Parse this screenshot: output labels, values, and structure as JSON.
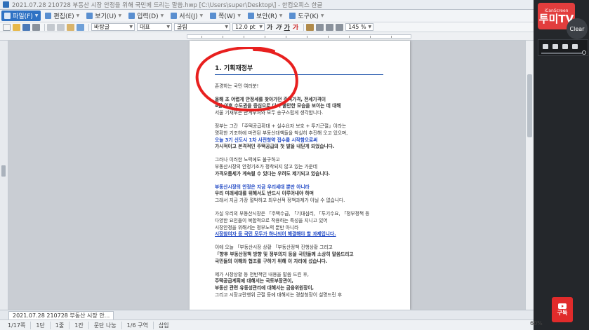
{
  "window": {
    "title": "2021.07.28 210728 부동산 시장 안정을 위해 국민께 드리는 말씀.hwp [C:\\Users\\super\\Desktop\\] - 한컴오피스 한글"
  },
  "menubar": {
    "items": [
      {
        "label": "파일(F)",
        "active": true
      },
      {
        "label": "편집(E)"
      },
      {
        "label": "보기(U)"
      },
      {
        "label": "입력(D)"
      },
      {
        "label": "서식(J)"
      },
      {
        "label": "쪽(W)"
      },
      {
        "label": "보안(R)"
      },
      {
        "label": "도구(K)"
      }
    ]
  },
  "toolbar": {
    "style": "바탕글",
    "font_group": "대표",
    "font": "굴림",
    "font_size": "12.0",
    "font_unit": "pt",
    "zoom_field": "145",
    "zoom_unit": "%",
    "bold_glyph": "가",
    "italic_glyph": "가",
    "underline_glyph": "가",
    "color_glyph": "가"
  },
  "document": {
    "heading": "1. 기획재정부",
    "greeting": "존경하는 국민 여러분!",
    "paragraphs": [
      [
        "올해 초 어렵게 안정세를 찾아가던 주택가격, 전세가격이",
        "4월 이후 수도권을 중심으로 다시 불안한 모습을 보이는 데 대해",
        "서울 기재부는 관계부처와 모두 송구스럽게 생각합니다."
      ],
      [
        "정부는 그간 「주택공급확대 + 실수요자 보호 + 투기근절」이라는",
        "명확한 기조하에 마련된 부동산대책들을 착실히 추진해 오고 있으며,",
        "오늘 3기 신도시 1차 사전청약 접수를 시작함으로써",
        "가시적이고 본격적인 주택공급의 첫 발을 내딛게 되었습니다."
      ],
      [
        "그러나 이러한 노력에도 불구하고",
        "부동산시장의 안정기조가 정착되지 않고 있는 가운데",
        "가격오름세가 계속될 수 있다는 우려도 제기되고 있습니다."
      ],
      [
        "부동산시장의 안정은 지금 우리세대 뿐만 아니라",
        "우리 미래세대를 위해서도 반드시 이루어내야 하며",
        "그래서 지금 가장 절박하고 최우선적 정책과제가 아닐 수 없습니다."
      ],
      [
        "가실 우리의 부동산시장은 「주택수급, 「기대심리, 「투기수요, 「정부정책 등",
        "다양한 요인들이 복합적으로 작용하는 특성을 지니고 있어",
        "시장안정을 위해서는 정부노력 뿐만 아니라",
        "시장참여자 등 국민 모두가 하나되어 해결해야 할 과제입니다."
      ],
      [
        "이에 오늘 「부동산시장 상황 「부동산정책 진행상황 그리고",
        "「향후 부동산정책 방향 및 정부의지 등을 국민들께 소상히 말씀드리고",
        "국민들의 이해와 협조를 구하기 위해 이 자리에 섰습니다."
      ],
      [
        "제가 시장상황 등 전반적인 내용을 말씀 드린 후,",
        "주택공급계획에 대해서는 국토부장관이,",
        "부동산 관련 유동성관리에 대해서는 금융위원장이,",
        "그리고 시장교란행위 근절 등에 대해서는 경찰청장이 설명드린 후"
      ]
    ]
  },
  "tabbar": {
    "doc_tab": "2021.07.28 210728 부동산 시장 안..."
  },
  "statusbar": {
    "page": "1/17쪽",
    "section": "1단",
    "line": "1줄",
    "column": "1칸",
    "break": "문단 나눔",
    "area": "1/6 구역",
    "mode": "삽입",
    "zoom": "60%"
  },
  "overlay": {
    "brand_small": "iCanScreen",
    "brand_big": "투미TV",
    "clear_label": "Clear",
    "subscribe_label": "구독"
  },
  "colors": {
    "accent": "#2f72c4",
    "annotation_red": "#e8201f",
    "emphasis_blue": "#2149c5",
    "brand_red": "#e23d3d"
  }
}
